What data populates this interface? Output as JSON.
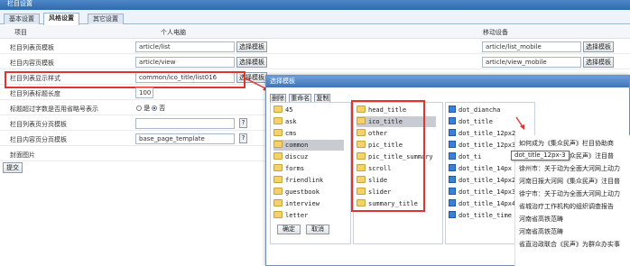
{
  "window": {
    "title": "栏目设置"
  },
  "tabs": [
    {
      "label": "基本设置"
    },
    {
      "label": "风格设置"
    },
    {
      "label": "其它设置"
    }
  ],
  "grid_header": {
    "item": "项目",
    "pc": "个人电脑",
    "mobile": "移动设备"
  },
  "rows": [
    {
      "label": "栏目列表页模板",
      "pc_value": "article/list",
      "pc_button": "选择模板",
      "mobile_value": "article/list_mobile",
      "mobile_button": "选择模板"
    },
    {
      "label": "栏目内容页模板",
      "pc_value": "article/view",
      "pc_button": "选择模板",
      "mobile_value": "article/view_mobile",
      "mobile_button": "选择模板"
    },
    {
      "label": "栏目列表显示样式",
      "pc_value": "common/ico_title/list016",
      "pc_button": "选择模板"
    },
    {
      "label": "栏目列表标题长度",
      "pc_value": "100"
    },
    {
      "label": "标题超过字数是否用省略号表示",
      "opt_yes": "是",
      "opt_no": "否"
    },
    {
      "label": "栏目列表页分页模板",
      "help": "?"
    },
    {
      "label": "栏目内容页分页模板",
      "pc_value": "base_page_template",
      "help": "?"
    },
    {
      "label": "封面图片"
    }
  ],
  "save_button": "提交",
  "dialog": {
    "title": "选择模板",
    "tools": [
      "删除",
      "重命名",
      "复制"
    ],
    "col1": [
      "45",
      "ask",
      "cms",
      "common",
      "discuz",
      "forms",
      "friendlink",
      "guestbook",
      "interview",
      "letter"
    ],
    "col2": [
      "head_title",
      "ico_title",
      "other",
      "pic_title",
      "pic_title_summary",
      "scroll",
      "slide",
      "slider",
      "summary_title"
    ],
    "col3": [
      "dot_diancha",
      "dot_title",
      "dot_title_12px2",
      "dot_title_12px3",
      "dot_ti",
      "dot_title_14px",
      "dot_title_14px2",
      "dot_title_14px3",
      "dot_title_14px4",
      "dot_title_time"
    ],
    "ok": "确定",
    "cancel": "取消"
  },
  "tooltip": "dot_title_12px-3",
  "preview_items": [
    "如何成为《集众民声》栏目协助商",
    "商国振大河网《集众民声》注目普",
    "徐州市：关于动为全面大河网上动力",
    "河南日报大河网《集众民声》注目普",
    "徐宁市：关于动为全面大河网上动力",
    "省城治疗工作机构的组织调查报告",
    "河南省高铁范畴",
    "河南省高铁范畴",
    "省直治政联合《民声》为群众办实事"
  ],
  "colors": {
    "titlebar": "#3e74b8",
    "highlight": "#e0342f",
    "folder": "#f3d26a",
    "file": "#3c7fd6"
  }
}
